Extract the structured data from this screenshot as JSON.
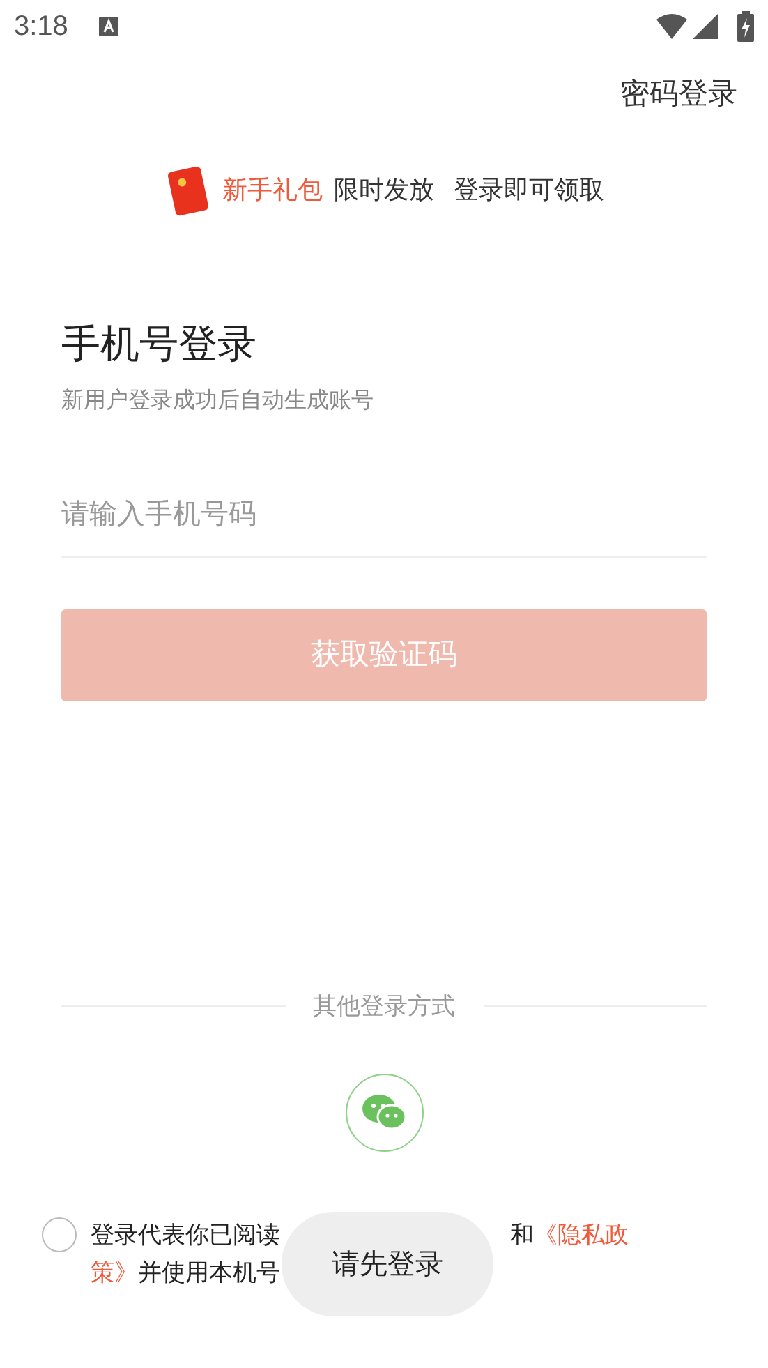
{
  "status_bar": {
    "time": "3:18"
  },
  "top_link": "密码登录",
  "promo": {
    "highlight": "新手礼包",
    "text_1": "限时发放",
    "text_2": "登录即可领取"
  },
  "title": "手机号登录",
  "subtitle": "新用户登录成功后自动生成账号",
  "phone_field": {
    "placeholder": "请输入手机号码"
  },
  "submit_button": {
    "label": "获取验证码",
    "disabled": true
  },
  "other_login": {
    "label": "其他登录方式"
  },
  "agreement": {
    "checked": false,
    "line_1": [
      {
        "kind": "text",
        "text": "登录代表你已阅读"
      },
      {
        "kind": "gap"
      },
      {
        "kind": "text",
        "text": "和"
      },
      {
        "kind": "link",
        "text": "《隐私政"
      }
    ],
    "line_2": [
      {
        "kind": "link",
        "text": "策》"
      },
      {
        "kind": "text",
        "text": "并使用本机号"
      }
    ]
  },
  "toast": "请先登录"
}
